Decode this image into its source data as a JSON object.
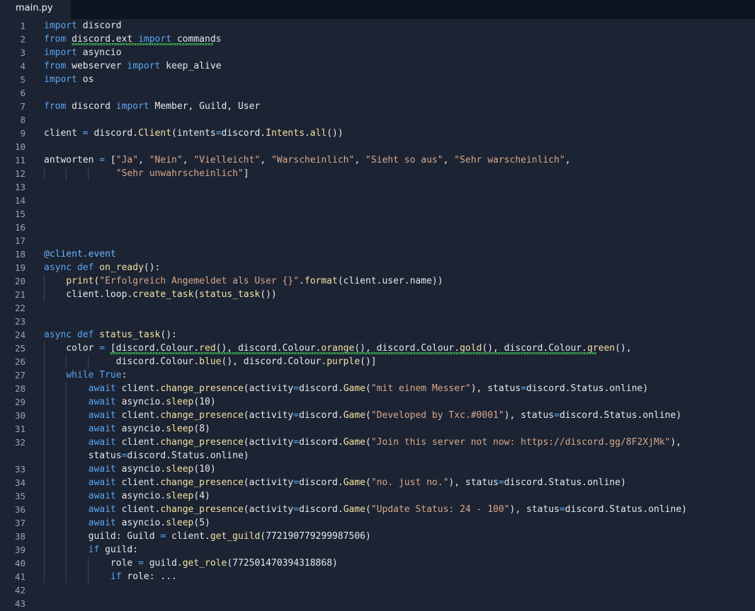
{
  "tab": {
    "filename": "main.py"
  },
  "lines": [
    {
      "num": "1",
      "text": "import discord"
    },
    {
      "num": "2",
      "text": "from discord.ext import commands"
    },
    {
      "num": "3",
      "text": "import asyncio"
    },
    {
      "num": "4",
      "text": "from webserver import keep_alive"
    },
    {
      "num": "5",
      "text": "import os"
    },
    {
      "num": "6",
      "text": ""
    },
    {
      "num": "7",
      "text": "from discord import Member, Guild, User"
    },
    {
      "num": "8",
      "text": ""
    },
    {
      "num": "9",
      "text": "client = discord.Client(intents=discord.Intents.all())"
    },
    {
      "num": "10",
      "text": ""
    },
    {
      "num": "11",
      "text": "antworten = [\"Ja\", \"Nein\", \"Vielleicht\", \"Warscheinlich\", \"Sieht so aus\", \"Sehr warscheinlich\","
    },
    {
      "num": "12",
      "text": "             \"Sehr unwahrscheinlich\"]"
    },
    {
      "num": "13",
      "text": ""
    },
    {
      "num": "14",
      "text": ""
    },
    {
      "num": "15",
      "text": ""
    },
    {
      "num": "16",
      "text": ""
    },
    {
      "num": "17",
      "text": ""
    },
    {
      "num": "18",
      "text": "@client.event"
    },
    {
      "num": "19",
      "text": "async def on_ready():"
    },
    {
      "num": "20",
      "text": "    print(\"Erfolgreich Angemeldet als User {}\".format(client.user.name))"
    },
    {
      "num": "21",
      "text": "    client.loop.create_task(status_task())"
    },
    {
      "num": "22",
      "text": ""
    },
    {
      "num": "23",
      "text": ""
    },
    {
      "num": "24",
      "text": "async def status_task():"
    },
    {
      "num": "25",
      "text": "    color = [discord.Colour.red(), discord.Colour.orange(), discord.Colour.gold(), discord.Colour.green(),"
    },
    {
      "num": "26",
      "text": "             discord.Colour.blue(), discord.Colour.purple()]"
    },
    {
      "num": "27",
      "text": "    while True:"
    },
    {
      "num": "28",
      "text": "        await client.change_presence(activity=discord.Game(\"mit einem Messer\"), status=discord.Status.online)"
    },
    {
      "num": "29",
      "text": "        await asyncio.sleep(10)"
    },
    {
      "num": "30",
      "text": "        await client.change_presence(activity=discord.Game(\"Developed by Txc.#0001\"), status=discord.Status.online)"
    },
    {
      "num": "31",
      "text": "        await asyncio.sleep(8)"
    },
    {
      "num": "32",
      "text": "        await client.change_presence(activity=discord.Game(\"Join this server not now: https://discord.gg/8F2XjMk\"),"
    },
    {
      "num": "",
      "text": "        status=discord.Status.online)"
    },
    {
      "num": "33",
      "text": "        await asyncio.sleep(10)"
    },
    {
      "num": "34",
      "text": "        await client.change_presence(activity=discord.Game(\"no. just no.\"), status=discord.Status.online)"
    },
    {
      "num": "35",
      "text": "        await asyncio.sleep(4)"
    },
    {
      "num": "36",
      "text": "        await client.change_presence(activity=discord.Game(\"Update Status: 24 - 100\"), status=discord.Status.online)"
    },
    {
      "num": "37",
      "text": "        await asyncio.sleep(5)"
    },
    {
      "num": "38",
      "text": "        guild: Guild = client.get_guild(772190779299987506)"
    },
    {
      "num": "39",
      "text": "        if guild:"
    },
    {
      "num": "40",
      "text": "            role = guild.get_role(772501470394318868)"
    },
    {
      "num": "41",
      "text": "            if role: ..."
    },
    {
      "num": "42",
      "text": ""
    },
    {
      "num": "43",
      "text": ""
    }
  ]
}
